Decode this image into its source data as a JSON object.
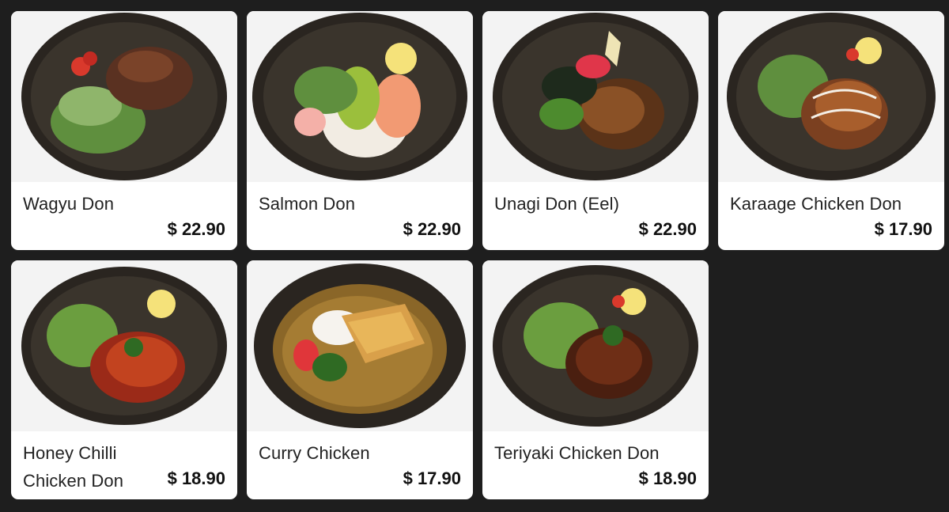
{
  "menu": {
    "items": [
      {
        "name": "Wagyu Don",
        "price": "$ 22.90",
        "icon": "wagyu-don-image"
      },
      {
        "name": "Salmon Don",
        "price": "$ 22.90",
        "icon": "salmon-don-image"
      },
      {
        "name": "Unagi Don (Eel)",
        "price": "$ 22.90",
        "icon": "unagi-don-image"
      },
      {
        "name": "Karaage Chicken Don",
        "price": "$ 17.90",
        "icon": "karaage-chicken-don-image"
      },
      {
        "name": "Honey Chilli Chicken Don",
        "price": "$ 18.90",
        "icon": "honey-chilli-chicken-don-image"
      },
      {
        "name": "Curry Chicken",
        "price": "$ 17.90",
        "icon": "curry-chicken-image"
      },
      {
        "name": "Teriyaki Chicken Don",
        "price": "$ 18.90",
        "icon": "teriyaki-chicken-don-image"
      }
    ]
  },
  "colors": {
    "background": "#1e1e1e",
    "card": "#ffffff",
    "bowl": "#2b2620"
  }
}
